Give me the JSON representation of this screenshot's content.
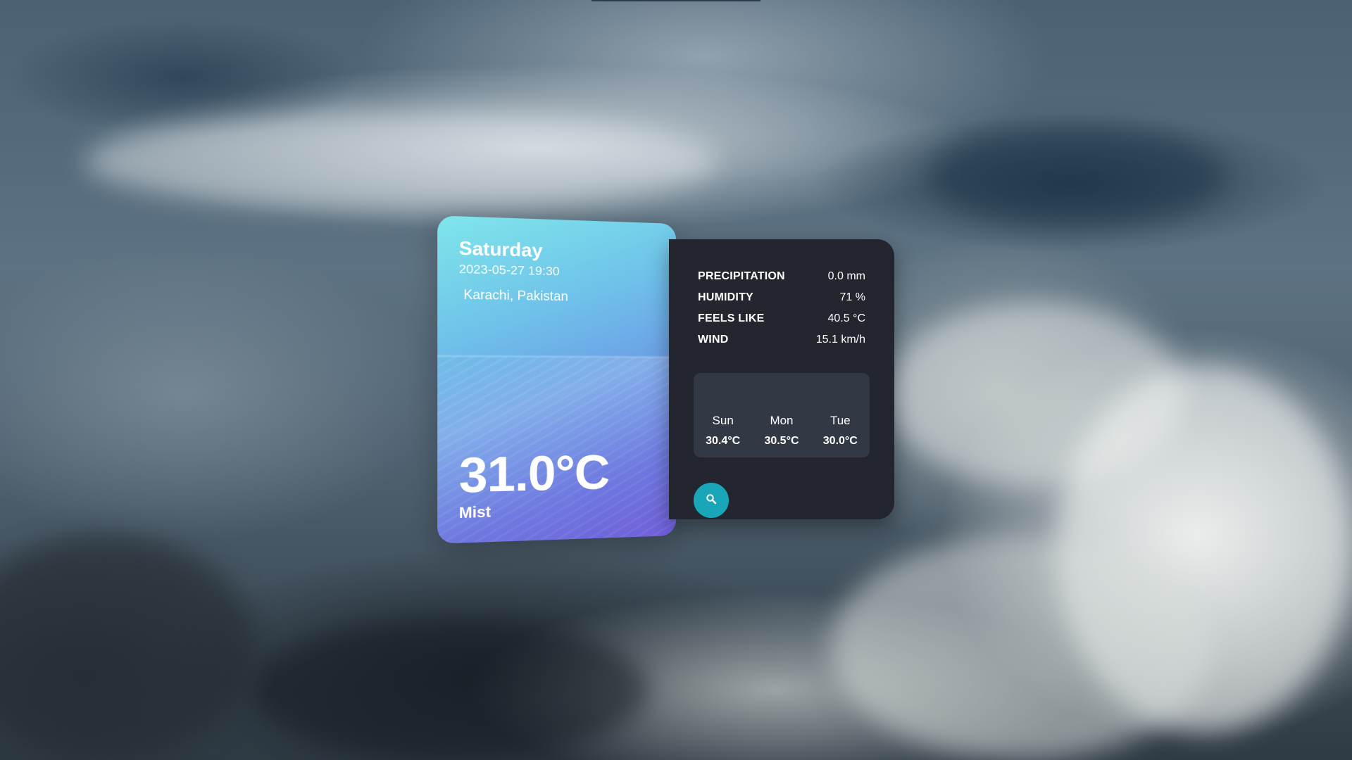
{
  "today": {
    "day": "Saturday",
    "datetime": "2023-05-27 19:30",
    "location": "Karachi, Pakistan",
    "temperature": "31.0°C",
    "description": "Mist"
  },
  "details": [
    {
      "label": "PRECIPITATION",
      "value": "0.0 mm"
    },
    {
      "label": "HUMIDITY",
      "value": "71 %"
    },
    {
      "label": "FEELS LIKE",
      "value": "40.5 °C"
    },
    {
      "label": "WIND",
      "value": "15.1 km/h"
    }
  ],
  "forecast": [
    {
      "day": "Sun",
      "temp": "30.4°C"
    },
    {
      "day": "Mon",
      "temp": "30.5°C"
    },
    {
      "day": "Tue",
      "temp": "30.0°C"
    }
  ],
  "search_button": {
    "icon": "search-icon"
  },
  "colors": {
    "panel_bg": "#23262f",
    "forecast_bg": "#333845",
    "accent": "#19a6b8"
  }
}
